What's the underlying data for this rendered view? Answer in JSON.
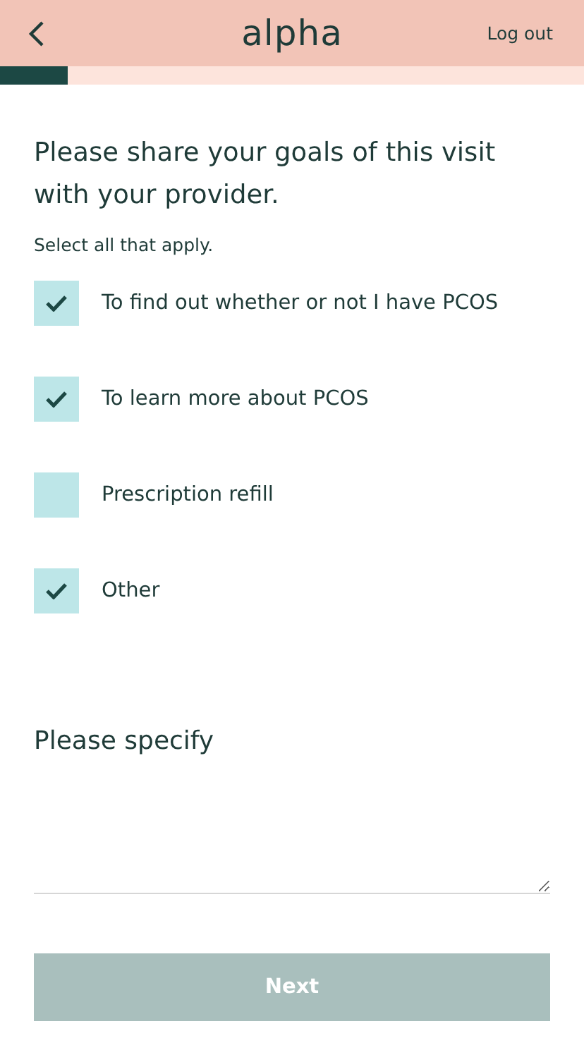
{
  "header": {
    "logo": "alpha",
    "logout": "Log out"
  },
  "progress": {
    "level": 0.115
  },
  "question": {
    "title": "Please share your goals of this visit with your provider.",
    "hint": "Select all that apply."
  },
  "options": [
    {
      "label": "To find out whether or not I have PCOS",
      "checked": true
    },
    {
      "label": "To learn more about PCOS",
      "checked": true
    },
    {
      "label": "Prescription refill",
      "checked": false
    },
    {
      "label": "Other",
      "checked": true
    }
  ],
  "specify": {
    "label": "Please specify"
  },
  "next": {
    "label": "Next",
    "disabled": true
  }
}
